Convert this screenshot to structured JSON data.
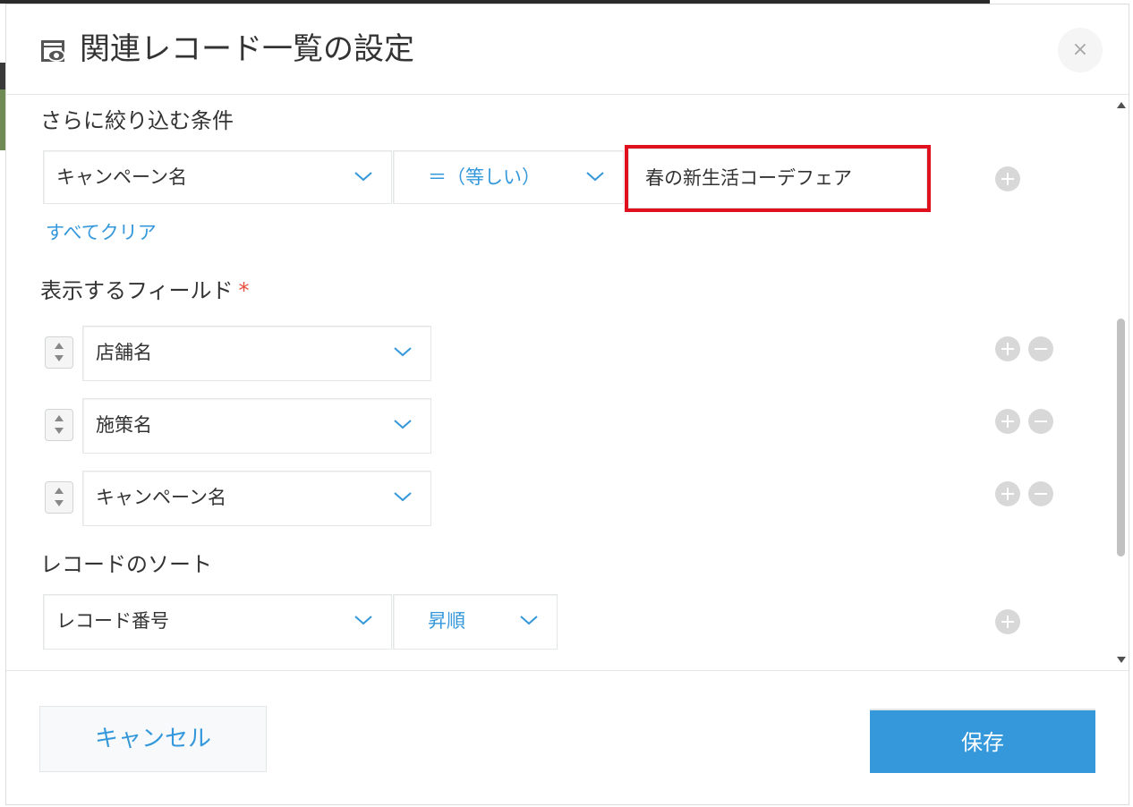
{
  "dialog": {
    "title": "関連レコード一覧の設定",
    "icon": "record-view-icon",
    "close_label": "×"
  },
  "filter": {
    "section_title": "さらに絞り込む条件",
    "field_value": "キャンペーン名",
    "operator_value": "＝（等しい）",
    "condition_value": "春の新生活コーデフェア",
    "clear_all_label": "すべてクリア"
  },
  "display_fields": {
    "section_title": "表示するフィールド",
    "required_mark": "*",
    "items": [
      {
        "value": "店舗名"
      },
      {
        "value": "施策名"
      },
      {
        "value": "キャンペーン名"
      }
    ]
  },
  "sort": {
    "section_title": "レコードのソート",
    "field_value": "レコード番号",
    "order_value": "昇順"
  },
  "footer": {
    "cancel_label": "キャンセル",
    "save_label": "保存"
  },
  "colors": {
    "accent": "#3498db",
    "highlight": "#e0101e",
    "required": "#e74c3c"
  }
}
